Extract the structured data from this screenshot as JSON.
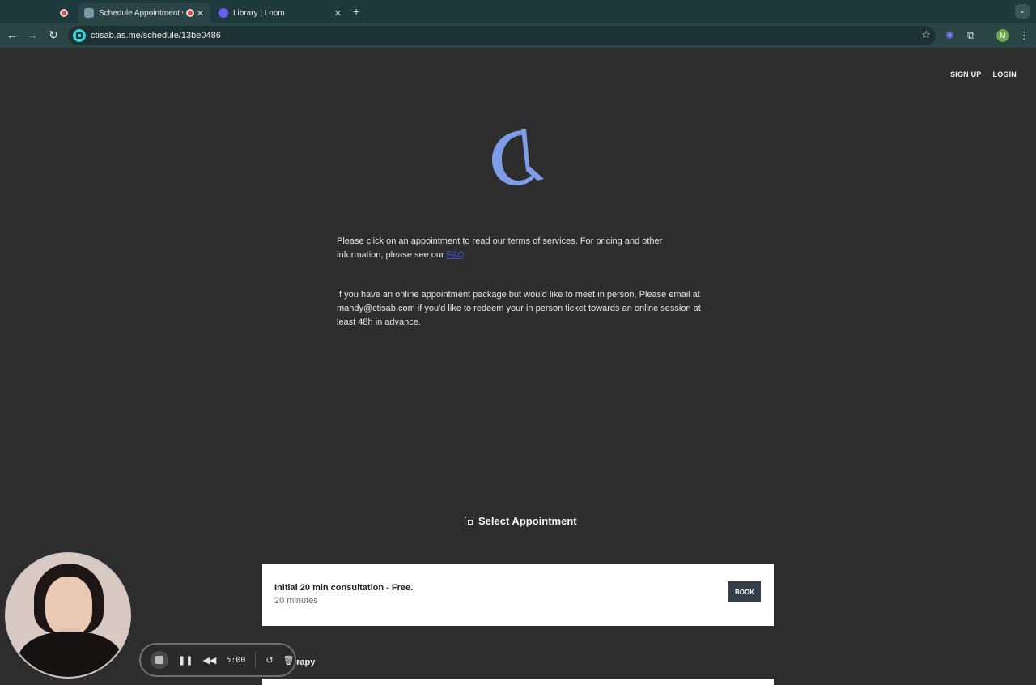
{
  "browser": {
    "tabs": [
      {
        "title": "Schedule Appointment w",
        "active": true
      },
      {
        "title": "Library | Loom",
        "active": false
      }
    ],
    "url": "ctisab.as.me/schedule/13be0486",
    "profile_initial": "M"
  },
  "page": {
    "nav": {
      "signup": "SIGN UP",
      "login": "LOGIN"
    },
    "intro_text": "Please click on an appointment to read our terms of services. For pricing and other information, please see our ",
    "faq_link": "FAQ",
    "intro2_text": "If you have an online appointment package but would like to meet in person, Please email at mandy@ctisab.com if you'd like to redeem your in person ticket towards an online session at least 48h in advance.",
    "select_title": "Select Appointment",
    "appointments": [
      {
        "name": "Initial 20 min consultation - Free.",
        "duration": "20 minutes",
        "button": "BOOK"
      }
    ],
    "next_section_partial": "erapy"
  },
  "recorder": {
    "timer": "5:00"
  },
  "colors": {
    "page_bg": "#2d2d2d",
    "logo": "#7f9de6",
    "link": "#3a53d6",
    "button": "#333e48"
  }
}
